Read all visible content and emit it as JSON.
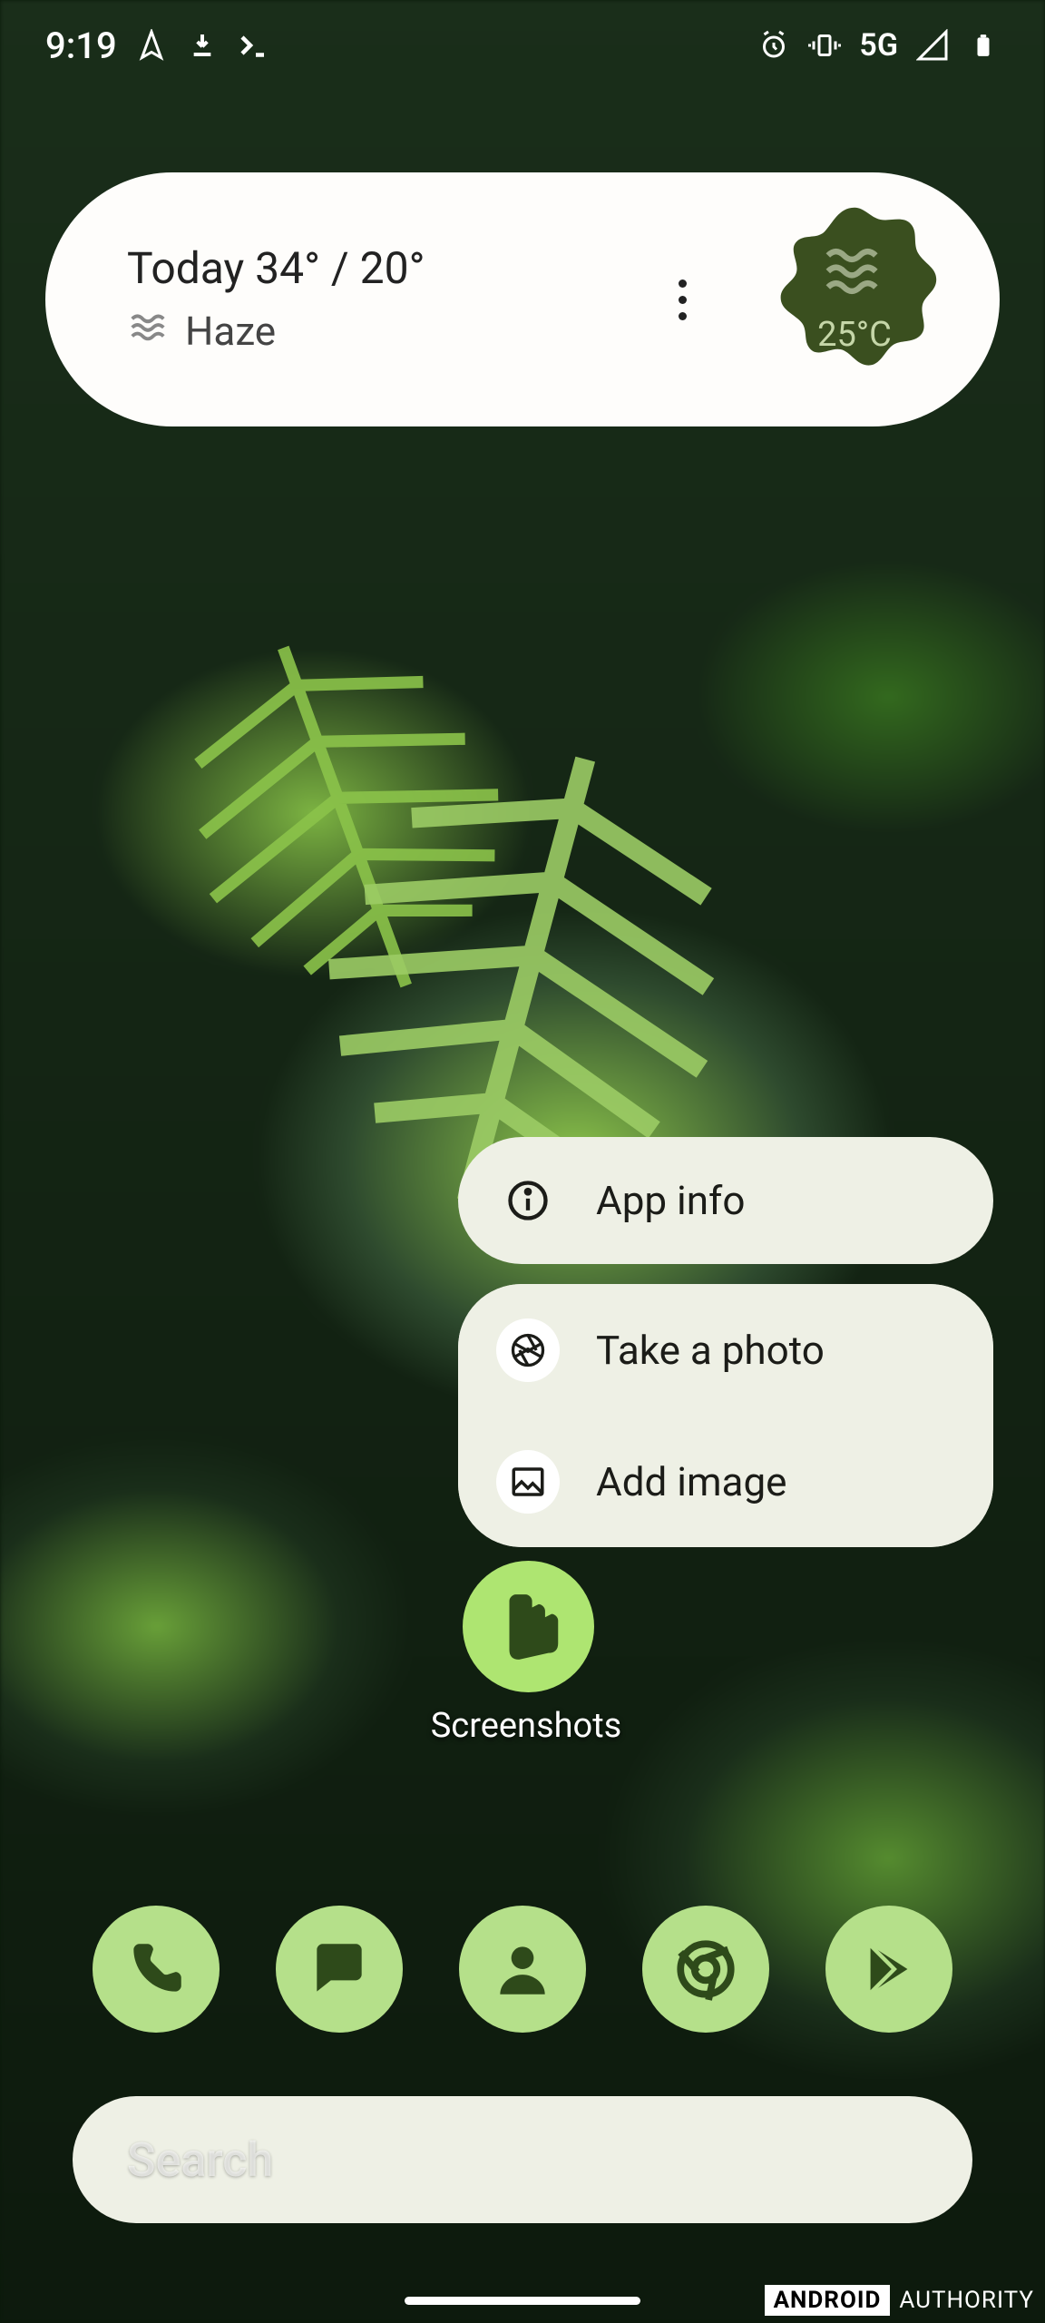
{
  "status": {
    "time": "9:19",
    "network": "5G"
  },
  "weather": {
    "today_line": "Today 34° / 20°",
    "condition": "Haze",
    "badge_temp": "25°C"
  },
  "context_menu": {
    "app_info": "App info",
    "take_photo": "Take a photo",
    "add_image": "Add image"
  },
  "highlighted_app": {
    "label": "Screenshots"
  },
  "search": {
    "placeholder": "Search"
  },
  "watermark": {
    "brand": "ANDROID",
    "suffix": "AUTHORITY"
  }
}
